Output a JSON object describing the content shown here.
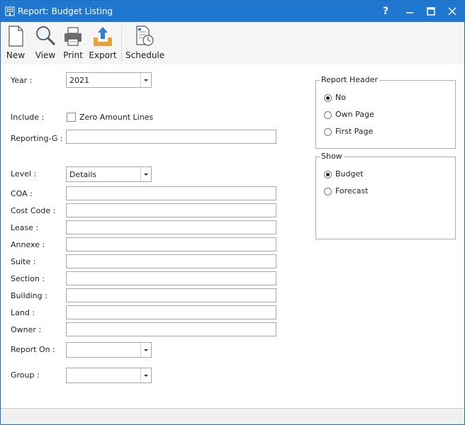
{
  "window": {
    "title": "Report: Budget Listing",
    "controls": {
      "help": "?",
      "minimize": "–",
      "maximize": "□",
      "close": "✕"
    }
  },
  "toolbar": {
    "new_label": "New",
    "view_label": "View",
    "print_label": "Print",
    "export_label": "Export",
    "schedule_label": "Schedule"
  },
  "form": {
    "year_label": "Year :",
    "year_value": "2021",
    "include_label": "Include :",
    "zero_amount_label": "Zero Amount Lines",
    "zero_amount_checked": false,
    "reporting_group_label": "Reporting-G :",
    "level_label": "Level :",
    "level_value": "Details",
    "coa_label": "COA :",
    "cost_code_label": "Cost Code :",
    "lease_label": "Lease :",
    "annexe_label": "Annexe :",
    "suite_label": "Suite :",
    "section_label": "Section :",
    "building_label": "Building :",
    "land_label": "Land :",
    "owner_label": "Owner :",
    "report_on_label": "Report On :",
    "report_on_value": "",
    "group_label": "Group :",
    "group_value": ""
  },
  "report_header": {
    "title": "Report Header",
    "options": [
      "No",
      "Own Page",
      "First Page"
    ],
    "selected": "No"
  },
  "show": {
    "title": "Show",
    "options": [
      "Budget",
      "Forecast"
    ],
    "selected": "Budget"
  }
}
